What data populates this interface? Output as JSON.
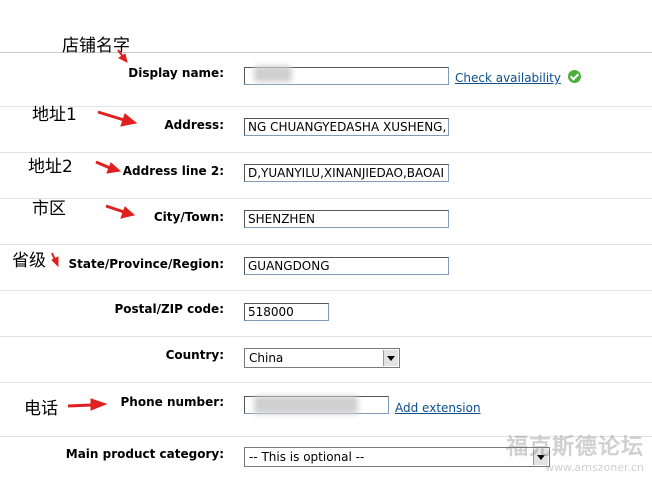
{
  "annotations": {
    "display_name": "店铺名字",
    "address": "地址1",
    "address_line_2": "地址2",
    "city": "市区",
    "state": "省级",
    "phone": "电话"
  },
  "form": {
    "display_name": {
      "label": "Display name:",
      "value": "",
      "link": "Check availability"
    },
    "address": {
      "label": "Address:",
      "value": "NG CHUANGYEDASHA XUSHENG,"
    },
    "address_line_2": {
      "label": "Address line 2:",
      "value": "D,YUANYILU,XINANJIEDAO,BAOAI"
    },
    "city": {
      "label": "City/Town:",
      "value": "SHENZHEN"
    },
    "state": {
      "label": "State/Province/Region:",
      "value": "GUANGDONG"
    },
    "postal": {
      "label": "Postal/ZIP code:",
      "value": "518000"
    },
    "country": {
      "label": "Country:",
      "selected": "China"
    },
    "phone": {
      "label": "Phone number:",
      "value": "",
      "link": "Add extension"
    },
    "category": {
      "label": "Main product category:",
      "selected": "-- This is optional --"
    }
  },
  "watermark": {
    "main": "福克斯德论坛",
    "sub": "www.amszoner.cn"
  },
  "colors": {
    "link": "#0a4f8c",
    "arrow": "#e02020",
    "check": "#4caf3a"
  }
}
